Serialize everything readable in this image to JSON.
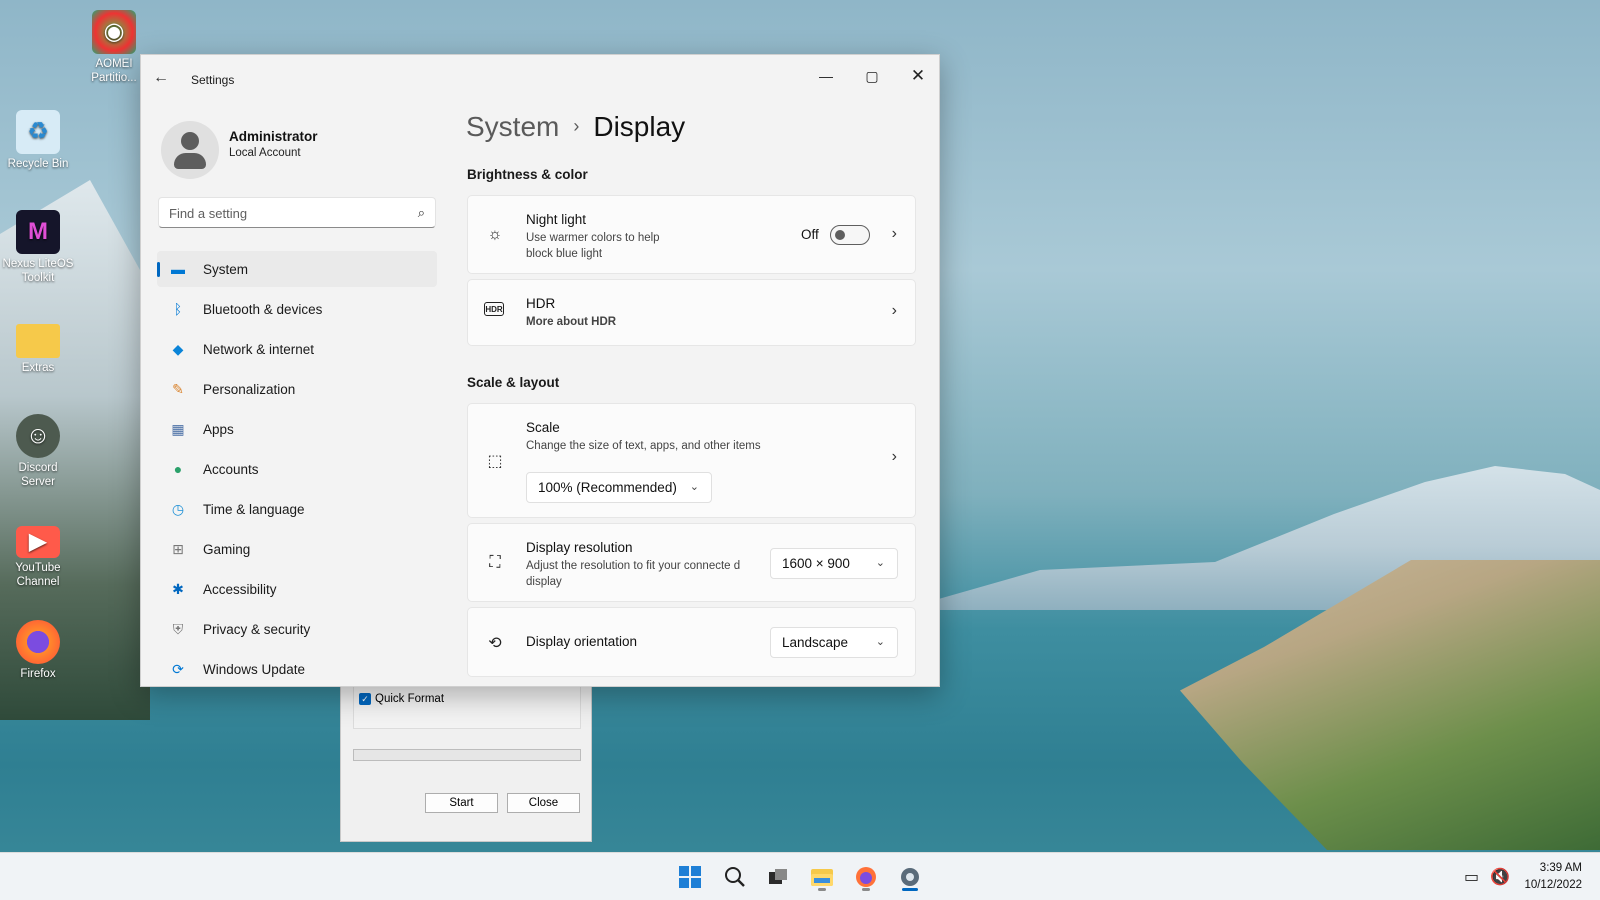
{
  "desktop": {
    "icons": [
      {
        "label": "AOMEI Partitio...",
        "glyph": "◉",
        "icon": "aomei-partition-icon",
        "color": "#d33"
      },
      {
        "label": "Recycle Bin",
        "glyph": "♻",
        "icon": "recycle-bin-icon",
        "color": "#cfe6f5"
      },
      {
        "label": "Nexus LiteOS Toolkit",
        "glyph": "M",
        "icon": "nexus-liteos-icon",
        "color": "#1a1a2a"
      },
      {
        "label": "Extras",
        "glyph": "",
        "icon": "folder-icon",
        "color": "#f6c94a"
      },
      {
        "label": "Discord Server",
        "glyph": "☺",
        "icon": "discord-icon",
        "color": "#5a6b5e"
      },
      {
        "label": "YouTube Channel",
        "glyph": "▶",
        "icon": "youtube-icon",
        "color": "#ff5a4a"
      },
      {
        "label": "Firefox",
        "glyph": "◐",
        "icon": "firefox-icon",
        "color": "#ff7139"
      }
    ]
  },
  "format_dialog": {
    "quick_format_label": "Quick Format",
    "quick_format_checked": true,
    "start_label": "Start",
    "close_label": "Close"
  },
  "window": {
    "app_title": "Settings",
    "profile": {
      "name": "Administrator",
      "subtitle": "Local Account"
    },
    "search": {
      "placeholder": "Find a setting"
    },
    "nav": [
      {
        "label": "System",
        "icon": "system-icon",
        "glyph": "▭",
        "color": "#0078d4",
        "active": true
      },
      {
        "label": "Bluetooth & devices",
        "icon": "bluetooth-icon",
        "glyph": "ᛒ",
        "color": "#0078d4"
      },
      {
        "label": "Network & internet",
        "icon": "network-icon",
        "glyph": "◆",
        "color": "#0a84d8"
      },
      {
        "label": "Personalization",
        "icon": "personalization-icon",
        "glyph": "✎",
        "color": "#d9822b"
      },
      {
        "label": "Apps",
        "icon": "apps-icon",
        "glyph": "▦",
        "color": "#4a6fa5"
      },
      {
        "label": "Accounts",
        "icon": "accounts-icon",
        "glyph": "●",
        "color": "#2aa06a"
      },
      {
        "label": "Time & language",
        "icon": "time-language-icon",
        "glyph": "◷",
        "color": "#1e90d6"
      },
      {
        "label": "Gaming",
        "icon": "gaming-icon",
        "glyph": "⊞",
        "color": "#777"
      },
      {
        "label": "Accessibility",
        "icon": "accessibility-icon",
        "glyph": "♿",
        "color": "#0067c0"
      },
      {
        "label": "Privacy & security",
        "icon": "shield-icon",
        "glyph": "⛨",
        "color": "#777"
      },
      {
        "label": "Windows Update",
        "icon": "windows-update-icon",
        "glyph": "⟳",
        "color": "#0078d4"
      }
    ],
    "breadcrumb": {
      "parent": "System",
      "current": "Display"
    },
    "sections": {
      "brightness": "Brightness & color",
      "scale_layout": "Scale & layout"
    },
    "night_light": {
      "title": "Night light",
      "desc": "Use warmer colors to help block blue light",
      "state": "Off"
    },
    "hdr": {
      "title": "HDR",
      "link": "More about HDR"
    },
    "scale": {
      "title": "Scale",
      "desc": "Change the size of text, apps, and other items",
      "value": "100% (Recommended)"
    },
    "resolution": {
      "title": "Display resolution",
      "desc": "Adjust the resolution to fit your connecte d display",
      "value": "1600 × 900"
    },
    "orientation": {
      "title": "Display orientation",
      "value": "Landscape"
    }
  },
  "taskbar": {
    "clock_time": "3:39 AM",
    "clock_date": "10/12/2022",
    "apps": [
      {
        "icon": "start-icon"
      },
      {
        "icon": "search-icon"
      },
      {
        "icon": "task-view-icon"
      },
      {
        "icon": "file-explorer-icon"
      },
      {
        "icon": "firefox-icon"
      },
      {
        "icon": "settings-icon"
      }
    ]
  }
}
